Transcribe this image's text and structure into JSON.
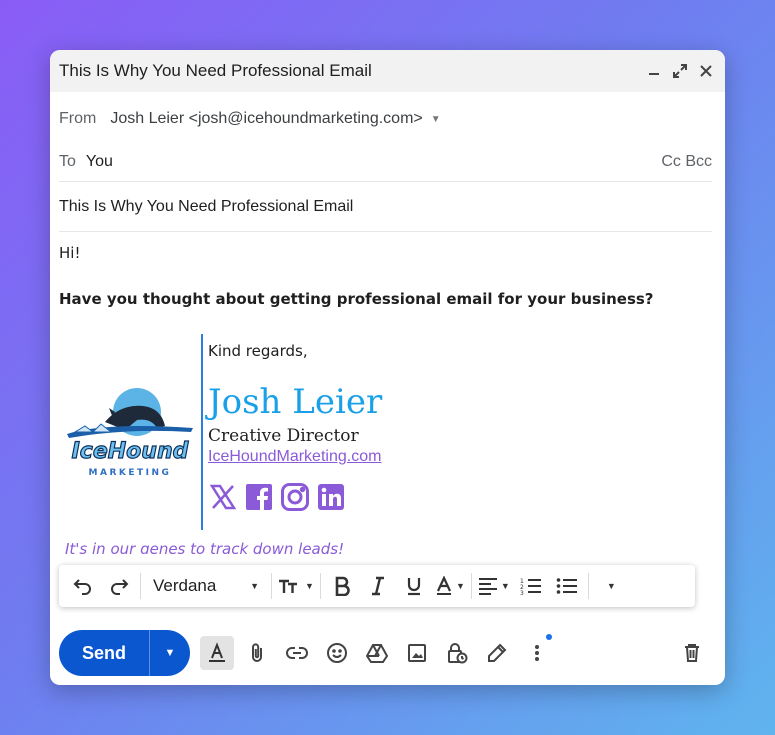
{
  "window": {
    "title": "This Is Why You Need Professional Email"
  },
  "header": {
    "from_label": "From",
    "from_value": "Josh Leier <josh@icehoundmarketing.com>",
    "to_label": "To",
    "to_value": "You",
    "cc_bcc": "Cc Bcc",
    "subject": "This Is Why You Need Professional Email"
  },
  "body": {
    "greeting": "Hi!",
    "question": "Have you thought about getting professional email for your business?"
  },
  "signature": {
    "regards": "Kind regards,",
    "name": "Josh Leier",
    "role": "Creative Director",
    "link": "IceHoundMarketing.com",
    "tagline": "It's in our genes to track down leads!",
    "logo_word": "IceHound",
    "logo_sub": "MARKETING",
    "socials": [
      "x-icon",
      "facebook-icon",
      "instagram-icon",
      "linkedin-icon"
    ]
  },
  "format_bar": {
    "font": "Verdana"
  },
  "footer": {
    "send": "Send"
  },
  "colors": {
    "accent": "#0b57d0",
    "signature_name": "#1aa0e8",
    "link": "#8b5ad8"
  }
}
